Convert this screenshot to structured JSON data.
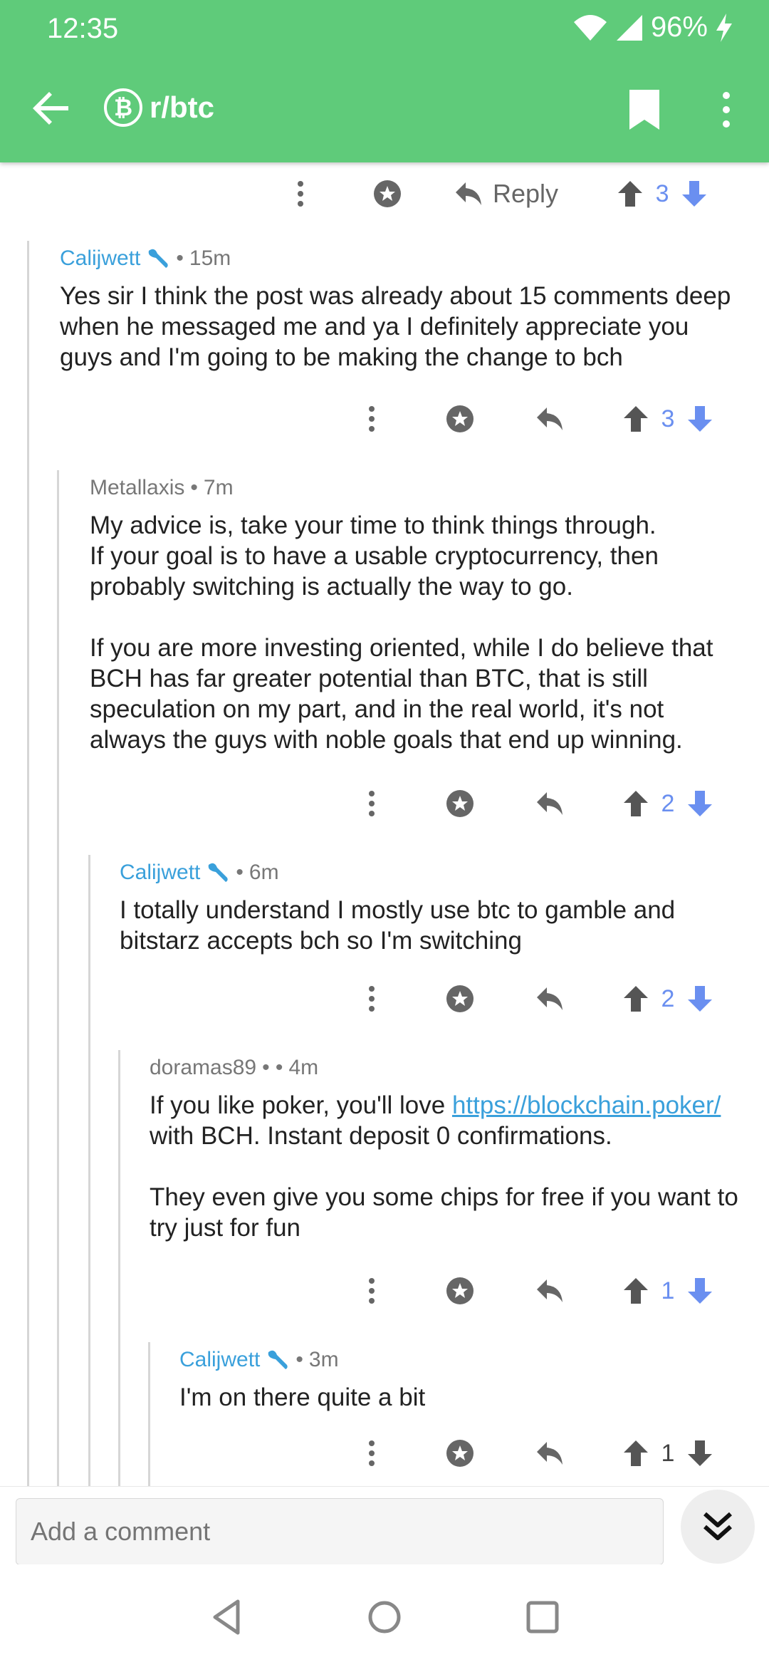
{
  "status_bar": {
    "time": "12:35",
    "battery": "96%"
  },
  "header": {
    "subreddit": "r/btc",
    "subreddit_icon": "bitcoin-cash-logo"
  },
  "parent_actions": {
    "reply_label": "Reply",
    "score": "3"
  },
  "comments": [
    {
      "author": "Calijwett",
      "separator": "•",
      "time": "15m",
      "body": "Yes sir I think the post was already about 15 comments deep when he messaged me and ya I definitely appreciate you guys and I'm going to be making the change to bch",
      "score": "3"
    },
    {
      "author": "Metallaxis",
      "separator": "•",
      "time": "7m",
      "body": "My advice is, take your time to think things through.\nIf your goal is to have a usable cryptocurrency, then probably switching is actually the way to go.\n\nIf you are more investing oriented, while I do believe that BCH has far greater potential than BTC, that is still speculation on my part, and in the real world, it's not always the guys with noble goals that end up winning.",
      "score": "2"
    },
    {
      "author": "Calijwett",
      "separator": "•",
      "time": "6m",
      "body": "I totally understand I mostly use btc to gamble and bitstarz accepts bch so I'm switching",
      "score": "2"
    },
    {
      "author": "doramas89",
      "separator": "•  •",
      "time": "4m",
      "body_prefix": "If you like poker, you'll love ",
      "link": "https://blockchain.poker/",
      "body_suffix": " with BCH. Instant deposit 0 confirmations.\n\nThey even give you some chips for free if you want to try just for fun",
      "score": "1"
    },
    {
      "author": "Calijwett",
      "separator": "•",
      "time": "3m",
      "body": "I'm on there quite a bit",
      "score": "1"
    }
  ],
  "bottom": {
    "comment_placeholder": "Add a comment"
  },
  "colors": {
    "app_bar": "#5fcb7a",
    "author": "#3aa0db",
    "vote_active": "#6a8ff0"
  }
}
